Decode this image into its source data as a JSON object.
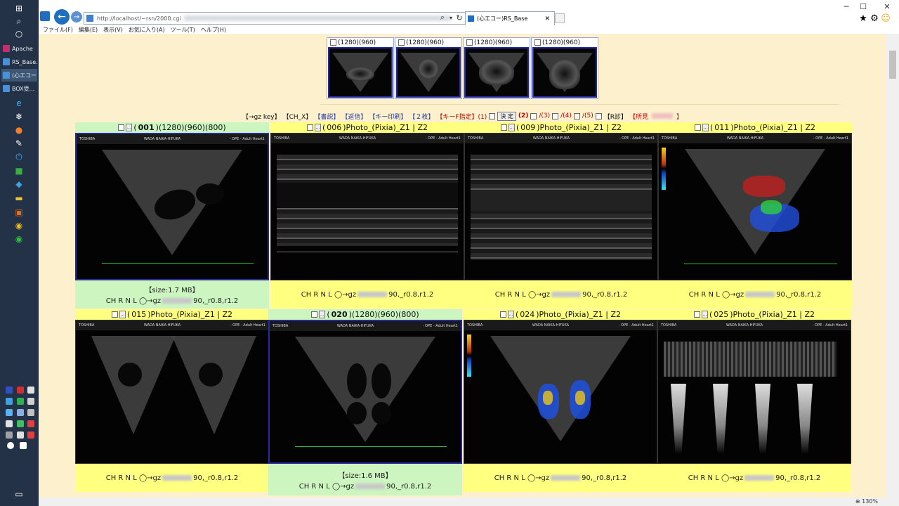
{
  "taskbar": {
    "items": [
      {
        "label": "Apache"
      },
      {
        "label": "RS_Base..."
      },
      {
        "label": "(心エコー..."
      },
      {
        "label": "BOX受..."
      }
    ]
  },
  "browser": {
    "url_prefix": "http://localhost/",
    "url_rest": "~rsn/2000.cgi",
    "tab_title": "(心エコー)RS_Base",
    "menu": [
      "ファイル(F)",
      "編集(E)",
      "表示(V)",
      "お気に入り(A)",
      "ツール(T)",
      "ヘルプ(H)"
    ],
    "zoom": "130%"
  },
  "thumbnails": [
    {
      "label": "(1280)(960)"
    },
    {
      "label": "(1280)(960)"
    },
    {
      "label": "(1280)(960)"
    },
    {
      "label": "(1280)(960)"
    }
  ],
  "toolbar": {
    "gz_key": "【→gz key】",
    "ch_x": "【CH_X】",
    "shosetsu": "【書説】",
    "hensin": "【返信】",
    "keyprint": "【キー印刷】",
    "two": "【２枚】",
    "keyspec": "【キーF指定】(1)",
    "kettei": "決 定",
    "opt2": "(2)",
    "opt3": "/(3)",
    "opt4": "/(4)",
    "opt5": "/(5)",
    "r": "【R診】",
    "shoken": "【所見",
    "shoken_end": "】"
  },
  "cells": [
    {
      "num": "001",
      "title_rest": ")(1280)(960)(800)",
      "size": "【size:1.7 MB】",
      "info_pre": "CH R N L ◯→gz",
      "info_post": "90,_r0.8,r1.2"
    },
    {
      "num": "006",
      "title_rest": ")Photo_(Pixia)_Z1 | Z2",
      "info_pre": "CH R N L ◯→gz",
      "info_post": "90,_r0.8,r1.2"
    },
    {
      "num": "009",
      "title_rest": ")Photo_(Pixia)_Z1 | Z2",
      "info_pre": "CH R N L ◯→gz",
      "info_post": "90,_r0.8,r1.2"
    },
    {
      "num": "011",
      "title_rest": ")Photo_(Pixia)_Z1 | Z2",
      "info_pre": "CH R N L ◯→gz",
      "info_post": "90,_r0.8,r1.2"
    },
    {
      "num": "015",
      "title_rest": ")Photo_(Pixia)_Z1 | Z2",
      "info_pre": "CH R N L ◯→gz",
      "info_post": "90,_r0.8,r1.2"
    },
    {
      "num": "020",
      "title_rest": ")(1280)(960)(800)",
      "size": "【size:1.6 MB】",
      "info_pre": "CH R N L ◯→gz",
      "info_post": "90,_r0.8,r1.2"
    },
    {
      "num": "024",
      "title_rest": ")Photo_(Pixia)_Z1 | Z2",
      "info_pre": "CH R N L ◯→gz",
      "info_post": "90,_r0.8,r1.2"
    },
    {
      "num": "025",
      "title_rest": ")Photo_(Pixia)_Z1 | Z2",
      "info_pre": "CH R N L ◯→gz",
      "info_post": "90,_r0.8,r1.2"
    }
  ],
  "overlay": {
    "brand": "TOSHIBA",
    "patient": "WADA NAIKA-HIFUKA",
    "mode": "- OPE -  Adult Heart1"
  }
}
